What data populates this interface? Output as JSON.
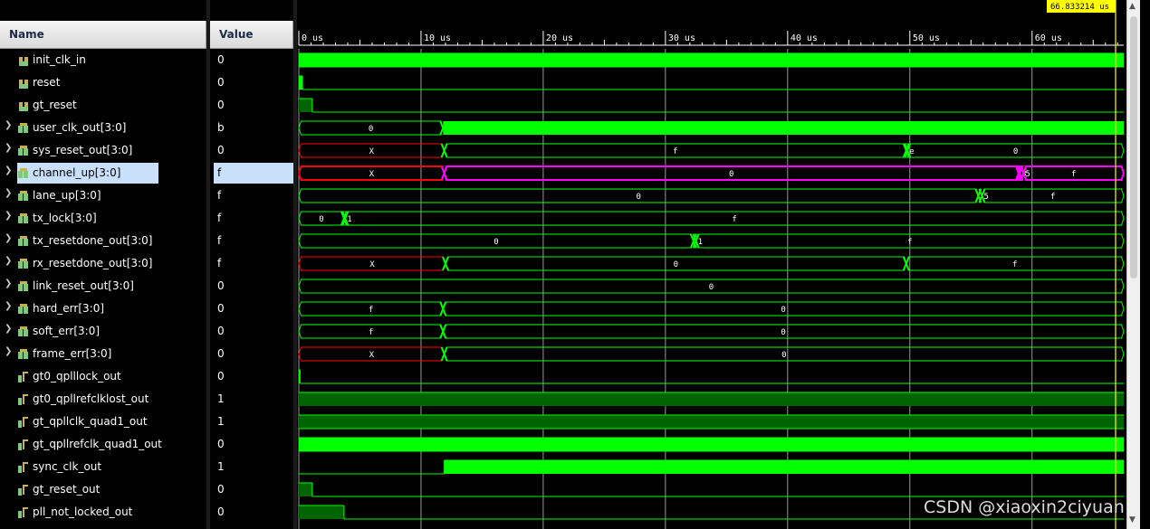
{
  "headers": {
    "name": "Name",
    "value": "Value"
  },
  "cursor": {
    "label": "66.833214 us",
    "time_us": 66.833214
  },
  "timeline": {
    "start_us": 0,
    "end_us": 67.5,
    "ticks": [
      {
        "t": 0,
        "label": "0 us"
      },
      {
        "t": 10,
        "label": "10 us"
      },
      {
        "t": 20,
        "label": "20 us"
      },
      {
        "t": 30,
        "label": "30 us"
      },
      {
        "t": 40,
        "label": "40 us"
      },
      {
        "t": 50,
        "label": "50 us"
      },
      {
        "t": 60,
        "label": "60 us"
      }
    ]
  },
  "colors": {
    "wave": "#00ff00",
    "highlight": "#ff00ff",
    "undefined": "#ff0000",
    "grid": "#ffffff",
    "cursor": "#ffff00",
    "selection": "#c9e0fb"
  },
  "signals": [
    {
      "name": "init_clk_in",
      "value": "0",
      "kind": "bit",
      "icon": "bit-signal-icon",
      "wave": {
        "type": "clock"
      }
    },
    {
      "name": "reset",
      "value": "0",
      "kind": "bit",
      "icon": "bit-signal-icon",
      "wave": {
        "type": "bit",
        "init": 1,
        "edges": [
          0.3
        ]
      }
    },
    {
      "name": "gt_reset",
      "value": "0",
      "kind": "bit",
      "icon": "bit-signal-icon",
      "wave": {
        "type": "bit",
        "init": 1,
        "edges": [
          1.1
        ],
        "dark": true
      }
    },
    {
      "name": "user_clk_out[3:0]",
      "value": "b",
      "kind": "bus",
      "icon": "bus-signal-icon",
      "expand": true,
      "wave": {
        "type": "bus",
        "segs": [
          {
            "t0": 0,
            "t1": 11.8,
            "label": "0"
          },
          {
            "t0": 11.8,
            "t1": 67.5,
            "label": "",
            "fill": true
          }
        ]
      }
    },
    {
      "name": "sys_reset_out[3:0]",
      "value": "0",
      "kind": "bus",
      "icon": "bus-signal-icon",
      "expand": true,
      "wave": {
        "type": "bus",
        "segs": [
          {
            "t0": 0,
            "t1": 11.9,
            "label": "X",
            "red": true
          },
          {
            "t0": 11.9,
            "t1": 49.7,
            "label": "f"
          },
          {
            "t0": 49.7,
            "t1": 49.8,
            "label": "e"
          },
          {
            "t0": 49.8,
            "t1": 67.5,
            "label": "0"
          }
        ]
      }
    },
    {
      "name": "channel_up[3:0]",
      "value": "f",
      "kind": "bus",
      "icon": "bus-signal-icon",
      "expand": true,
      "selected": true,
      "wave": {
        "type": "bus",
        "highlight": true,
        "segs": [
          {
            "t0": 0,
            "t1": 11.9,
            "label": "X",
            "red": true
          },
          {
            "t0": 11.9,
            "t1": 58.9,
            "label": "0"
          },
          {
            "t0": 58.9,
            "t1": 59.0,
            "label": "3"
          },
          {
            "t0": 59.0,
            "t1": 59.3,
            "label": "5"
          },
          {
            "t0": 59.3,
            "t1": 67.5,
            "label": "f"
          }
        ]
      }
    },
    {
      "name": "lane_up[3:0]",
      "value": "f",
      "kind": "bus",
      "icon": "bus-signal-icon",
      "expand": true,
      "wave": {
        "type": "bus",
        "segs": [
          {
            "t0": 0,
            "t1": 55.6,
            "label": "0"
          },
          {
            "t0": 55.6,
            "t1": 55.9,
            "label": "5"
          },
          {
            "t0": 55.9,
            "t1": 67.5,
            "label": "f"
          }
        ]
      }
    },
    {
      "name": "tx_lock[3:0]",
      "value": "f",
      "kind": "bus",
      "icon": "bus-signal-icon",
      "expand": true,
      "wave": {
        "type": "bus",
        "segs": [
          {
            "t0": 0,
            "t1": 3.7,
            "label": "0"
          },
          {
            "t0": 3.7,
            "t1": 3.8,
            "label": "1"
          },
          {
            "t0": 3.8,
            "t1": 67.5,
            "label": "f"
          }
        ]
      }
    },
    {
      "name": "tx_resetdone_out[3:0]",
      "value": "f",
      "kind": "bus",
      "icon": "bus-signal-icon",
      "expand": true,
      "wave": {
        "type": "bus",
        "segs": [
          {
            "t0": 0,
            "t1": 32.3,
            "label": "0"
          },
          {
            "t0": 32.3,
            "t1": 32.5,
            "label": "1"
          },
          {
            "t0": 32.5,
            "t1": 67.5,
            "label": "f"
          }
        ]
      }
    },
    {
      "name": "rx_resetdone_out[3:0]",
      "value": "f",
      "kind": "bus",
      "icon": "bus-signal-icon",
      "expand": true,
      "wave": {
        "type": "bus",
        "segs": [
          {
            "t0": 0,
            "t1": 12.0,
            "label": "X",
            "red": true
          },
          {
            "t0": 12.0,
            "t1": 49.7,
            "label": "0"
          },
          {
            "t0": 49.7,
            "t1": 67.5,
            "label": "f"
          }
        ]
      }
    },
    {
      "name": "link_reset_out[3:0]",
      "value": "0",
      "kind": "bus",
      "icon": "bus-signal-icon",
      "expand": true,
      "wave": {
        "type": "bus",
        "segs": [
          {
            "t0": 0,
            "t1": 67.5,
            "label": "0"
          }
        ]
      }
    },
    {
      "name": "hard_err[3:0]",
      "value": "0",
      "kind": "bus",
      "icon": "bus-signal-icon",
      "expand": true,
      "wave": {
        "type": "bus",
        "segs": [
          {
            "t0": 0,
            "t1": 11.8,
            "label": "f"
          },
          {
            "t0": 11.8,
            "t1": 67.5,
            "label": "0"
          }
        ]
      }
    },
    {
      "name": "soft_err[3:0]",
      "value": "0",
      "kind": "bus",
      "icon": "bus-signal-icon",
      "expand": true,
      "wave": {
        "type": "bus",
        "segs": [
          {
            "t0": 0,
            "t1": 11.8,
            "label": "f"
          },
          {
            "t0": 11.8,
            "t1": 67.5,
            "label": "0"
          }
        ]
      }
    },
    {
      "name": "frame_err[3:0]",
      "value": "0",
      "kind": "bus",
      "icon": "bus-signal-icon",
      "expand": true,
      "wave": {
        "type": "bus",
        "segs": [
          {
            "t0": 0,
            "t1": 11.9,
            "label": "X",
            "red": true
          },
          {
            "t0": 11.9,
            "t1": 67.5,
            "label": "0"
          }
        ]
      }
    },
    {
      "name": "gt0_qplllock_out",
      "value": "0",
      "kind": "bit",
      "icon": "output-signal-icon",
      "wave": {
        "type": "bit",
        "init": 1,
        "edges": [
          0.1
        ]
      }
    },
    {
      "name": "gt0_qpllrefclklost_out",
      "value": "1",
      "kind": "bit",
      "icon": "output-signal-icon",
      "wave": {
        "type": "bit",
        "init": 1,
        "edges": [],
        "dark": true
      }
    },
    {
      "name": "gt_qpllclk_quad1_out",
      "value": "1",
      "kind": "bit",
      "icon": "output-signal-icon",
      "wave": {
        "type": "clock",
        "dark": true
      }
    },
    {
      "name": "gt_qpllrefclk_quad1_out",
      "value": "0",
      "kind": "bit",
      "icon": "output-signal-icon",
      "wave": {
        "type": "clock"
      }
    },
    {
      "name": "sync_clk_out",
      "value": "1",
      "kind": "bit",
      "icon": "output-signal-icon",
      "wave": {
        "type": "bit",
        "init": 0,
        "edges": [
          11.9
        ]
      }
    },
    {
      "name": "gt_reset_out",
      "value": "0",
      "kind": "bit",
      "icon": "output-signal-icon",
      "wave": {
        "type": "bit",
        "init": 1,
        "edges": [
          1.1
        ],
        "dark": true
      }
    },
    {
      "name": "pll_not_locked_out",
      "value": "0",
      "kind": "bit",
      "icon": "output-signal-icon",
      "wave": {
        "type": "bit",
        "init": 1,
        "edges": [
          3.7
        ],
        "dark": true
      }
    }
  ],
  "watermark": "CSDN @xiaoxin2ciyuan"
}
